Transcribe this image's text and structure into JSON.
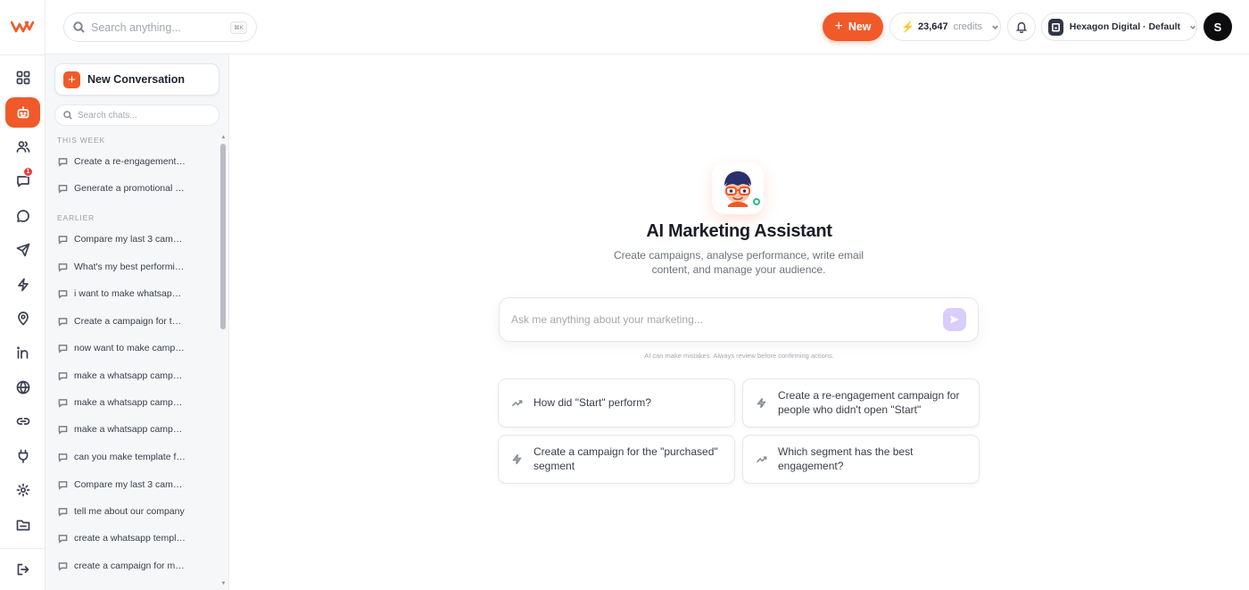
{
  "brand": {
    "logo_text": "w"
  },
  "rail": {
    "items": [
      {
        "name": "dashboard-icon",
        "active": false
      },
      {
        "name": "bot-icon",
        "active": true
      },
      {
        "name": "users-icon",
        "active": false
      },
      {
        "name": "messages-icon",
        "active": false,
        "badge": "1"
      },
      {
        "name": "chat-icon",
        "active": false
      },
      {
        "name": "send-icon",
        "active": false
      },
      {
        "name": "bolt-icon",
        "active": false
      },
      {
        "name": "location-icon",
        "active": false
      },
      {
        "name": "linkedin-icon",
        "active": false
      },
      {
        "name": "globe-icon",
        "active": false
      },
      {
        "name": "link-icon",
        "active": false
      },
      {
        "name": "plug-icon",
        "active": false
      },
      {
        "name": "gear-icon",
        "active": false
      },
      {
        "name": "folder-icon",
        "active": false
      },
      {
        "name": "logout-icon",
        "active": false
      }
    ]
  },
  "header": {
    "search_placeholder": "Search anything...",
    "search_shortcut": "⌘K",
    "new_button": "New",
    "credits_value": "23,647",
    "credits_label": "credits",
    "workspace": "Hexagon Digital · Default",
    "avatar_initial": "S"
  },
  "sidebar": {
    "new_conversation": "New Conversation",
    "search_placeholder": "Search chats...",
    "this_week_label": "THIS WEEK",
    "this_week": [
      "Create a re-engagement …",
      "Generate a promotional e…"
    ],
    "earlier_label": "EARLIER",
    "earlier": [
      "Compare my last 3 campa…",
      "What's my best performin…",
      "i want to make whatsapp …",
      "Create a campaign for the…",
      "now want to make campai…",
      "make a whatsapp campai…",
      "make a whatsapp campai…",
      "make a whatsapp campai…",
      "can you make template fo…",
      "Compare my last 3 campa…",
      "tell me about our company",
      "create a whatsapp templa…",
      "create a campaign for my …"
    ]
  },
  "main": {
    "title": "AI Marketing Assistant",
    "subtitle": "Create campaigns, analyse performance, write email content, and manage your audience.",
    "input_placeholder": "Ask me anything about your marketing...",
    "disclaimer": "AI can make mistakes. Always review before confirming actions.",
    "suggestions": [
      {
        "icon": "trend-icon",
        "text": "How did \"Start\" perform?"
      },
      {
        "icon": "bolt-icon",
        "text": "Create a re-engagement campaign for people who didn't open \"Start\""
      },
      {
        "icon": "bolt-icon",
        "text": "Create a campaign for the \"purchased\" segment"
      },
      {
        "icon": "trend-icon",
        "text": "Which segment has the best engagement?"
      }
    ]
  },
  "colors": {
    "accent": "#f05a2a",
    "online": "#1fc18a",
    "send_disabled": "#d8cdfb"
  }
}
